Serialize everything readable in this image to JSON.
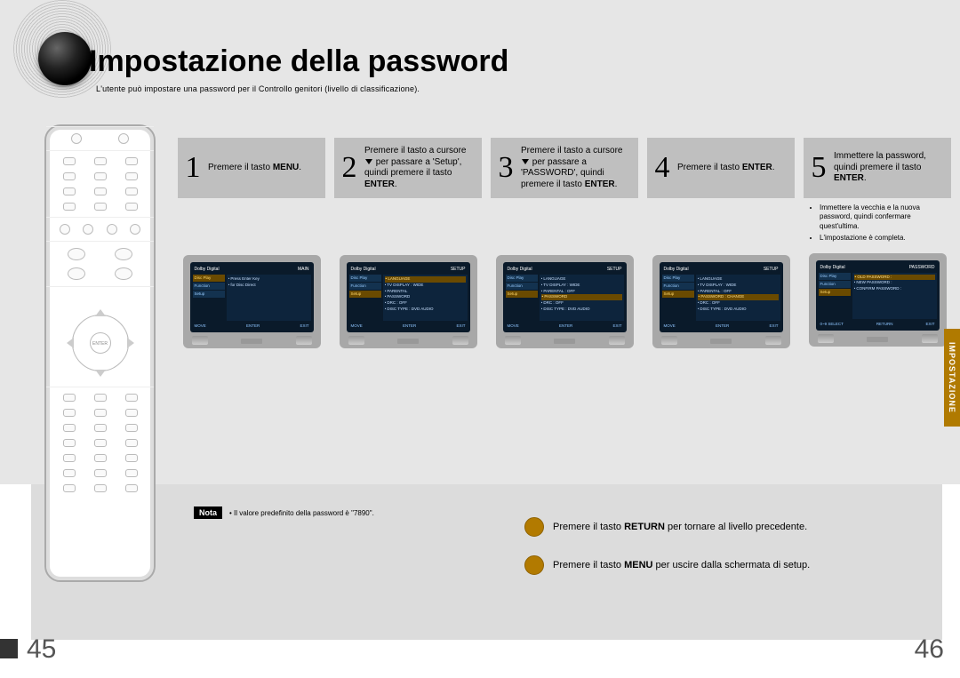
{
  "title": "Impostazione della password",
  "subtitle": "L'utente può impostare una password per il Controllo genitori (livello di classificazione).",
  "side_tab": "IMPOSTAZIONE",
  "remote_enter": "ENTER",
  "steps": [
    {
      "num": "1",
      "text_pre": "Premere il tasto ",
      "bold": "MENU",
      "text_post": ".",
      "screen": {
        "header_left": "Dolby Digital",
        "header_right": "MAIN",
        "side": [
          "Disc Play",
          "Function",
          "Setup"
        ],
        "active_side": 0,
        "main": [
          "Press Enter Key",
          "for Disc Direct"
        ],
        "highlight": -1,
        "foot": [
          "MOVE",
          "ENTER",
          "EXIT"
        ]
      }
    },
    {
      "num": "2",
      "text_pre": "Premere il tasto a cursore ",
      "tri": true,
      "text_mid": " per passare a 'Setup', quindi premere il tasto ",
      "bold": "ENTER",
      "text_post": ".",
      "screen": {
        "header_left": "Dolby Digital",
        "header_right": "SETUP",
        "side": [
          "Disc Play",
          "Function",
          "Setup"
        ],
        "active_side": 2,
        "main": [
          "LANGUAGE",
          "TV DISPLAY  : WIDE",
          "PARENTAL",
          "PASSWORD",
          "DRC  : OFF",
          "DISC TYPE  : DVD AUDIO"
        ],
        "highlight": 0,
        "foot": [
          "MOVE",
          "ENTER",
          "EXIT"
        ]
      }
    },
    {
      "num": "3",
      "text_pre": "Premere il tasto a cursore ",
      "tri": true,
      "text_mid": " per passare a 'PASSWORD', quindi premere il tasto ",
      "bold": "ENTER",
      "text_post": ".",
      "screen": {
        "header_left": "Dolby Digital",
        "header_right": "SETUP",
        "side": [
          "Disc Play",
          "Function",
          "Setup"
        ],
        "active_side": 2,
        "main": [
          "LANGUAGE",
          "TV DISPLAY  : WIDE",
          "PARENTAL  : OFF",
          "PASSWORD",
          "DRC  : OFF",
          "DISC TYPE  : DVD AUDIO"
        ],
        "highlight": 3,
        "foot": [
          "MOVE",
          "ENTER",
          "EXIT"
        ]
      }
    },
    {
      "num": "4",
      "text_pre": "Premere il tasto ",
      "bold": "ENTER",
      "text_post": ".",
      "screen": {
        "header_left": "Dolby Digital",
        "header_right": "SETUP",
        "side": [
          "Disc Play",
          "Function",
          "Setup"
        ],
        "active_side": 2,
        "main": [
          "LANGUAGE",
          "TV DISPLAY  : WIDE",
          "PARENTAL  : OFF",
          "PASSWORD  : CHANGE",
          "DRC  : OFF",
          "DISC TYPE  : DVD AUDIO"
        ],
        "highlight": 3,
        "foot": [
          "MOVE",
          "ENTER",
          "EXIT"
        ]
      }
    },
    {
      "num": "5",
      "text_pre": "Immettere la password, quindi premere il tasto ",
      "bold": "ENTER",
      "text_post": ".",
      "notes": [
        "Immettere la vecchia e la nuova password, quindi confermare quest'ultima.",
        "L'impostazione è completa."
      ],
      "screen": {
        "header_left": "Dolby Digital",
        "header_right": "PASSWORD",
        "side": [
          "Disc Play",
          "Function",
          "Setup"
        ],
        "active_side": 2,
        "main": [
          "OLD PASSWORD  :",
          "NEW PASSWORD  :",
          "CONFIRM PASSWORD  :"
        ],
        "highlight": 0,
        "foot": [
          "0~9 SELECT",
          "RETURN",
          "EXIT"
        ]
      }
    }
  ],
  "nota": {
    "label": "Nota",
    "text": "• Il valore predefinito della password è \"7890\"."
  },
  "tips": [
    {
      "pre": "Premere il tasto ",
      "bold": "RETURN",
      "post": " per tornare al livello precedente."
    },
    {
      "pre": "Premere il tasto ",
      "bold": "MENU",
      "post": " per uscire dalla schermata di setup."
    }
  ],
  "pages": {
    "left": "45",
    "right": "46"
  }
}
